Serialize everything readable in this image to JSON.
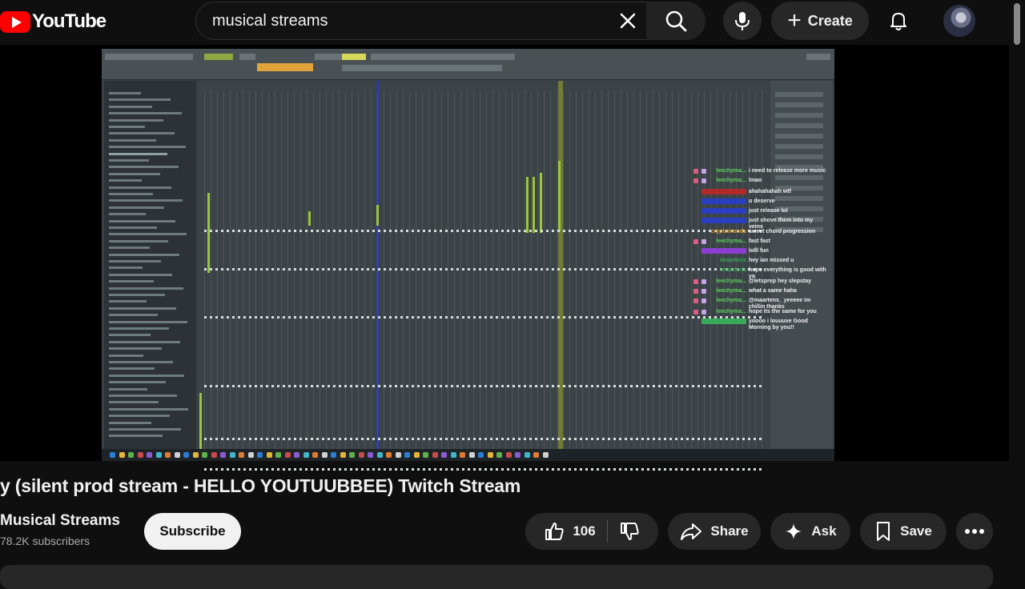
{
  "header": {
    "logo_text": "YouTube",
    "search_value": "musical streams",
    "create_label": "Create"
  },
  "video": {
    "title": "y (silent prod stream - HELLO YOUTUUBBEE) Twitch Stream",
    "channel_name": "Musical Streams",
    "subscribers": "78.2K subscribers",
    "subscribe_label": "Subscribe",
    "like_count": "106",
    "share_label": "Share",
    "ask_label": "Ask",
    "save_label": "Save"
  },
  "chat": [
    {
      "name": "leechyma...",
      "msg": "i need to release more music",
      "name_color": "#5ed35a",
      "badges": 2
    },
    {
      "name": "leechyma...",
      "msg": "lmao",
      "name_color": "#5ed35a",
      "badges": 2
    },
    {
      "name": "",
      "msg": "ahahahahah wtf",
      "name_color": "#b12a2a",
      "badges": 0
    },
    {
      "name": "",
      "msg": "u deserve",
      "name_color": "#2a3fc0",
      "badges": 0
    },
    {
      "name": "",
      "msg": "just release lol",
      "name_color": "#2a3fc0",
      "badges": 0
    },
    {
      "name": "",
      "msg": "just shove them into my veins",
      "name_color": "#2a3fc0",
      "badges": 0
    },
    {
      "name": "cryptomoods",
      "msg": "sweet chord progression",
      "name_color": "#d9a33a",
      "badges": 0
    },
    {
      "name": "leechyma...",
      "msg": "fast fast",
      "name_color": "#5ed35a",
      "badges": 2
    },
    {
      "name": "",
      "msg": "lolll fun",
      "name_color": "#8a3fd0",
      "badges": 0
    },
    {
      "name": "imaartens",
      "msg": "hey ian missed u",
      "name_color": "#3aa85a",
      "badges": 0
    },
    {
      "name": "imaartens",
      "msg": "hope everything is good with ya",
      "name_color": "#3aa85a",
      "badges": 0
    },
    {
      "name": "leechyma...",
      "msg": "@letsprep hey slepstay",
      "name_color": "#5ed35a",
      "badges": 2
    },
    {
      "name": "leechyma...",
      "msg": "what a same haha",
      "name_color": "#5ed35a",
      "badges": 2
    },
    {
      "name": "leechyma...",
      "msg": "@maartens_ yeeeee im chillin thanks",
      "name_color": "#5ed35a",
      "badges": 2
    },
    {
      "name": "leechyma...",
      "msg": "hope its the same for you",
      "name_color": "#5ed35a",
      "badges": 2
    },
    {
      "name": "",
      "msg": "yoooo i louuuve Good Morning by you!!",
      "name_color": "#3aa85a",
      "badges": 0
    }
  ],
  "icons": {
    "search": "search-icon",
    "clear": "close-icon",
    "mic": "mic-icon",
    "bell": "bell-icon",
    "like": "thumbs-up-icon",
    "dislike": "thumbs-down-icon",
    "share": "share-icon",
    "ask": "sparkle-icon",
    "save": "bookmark-icon",
    "more": "more-horizontal-icon"
  },
  "colors": {
    "background": "#0f0f0f",
    "brand_red": "#ff0000",
    "pill_bg": "#272727",
    "daw_green": "#9bc53d"
  }
}
